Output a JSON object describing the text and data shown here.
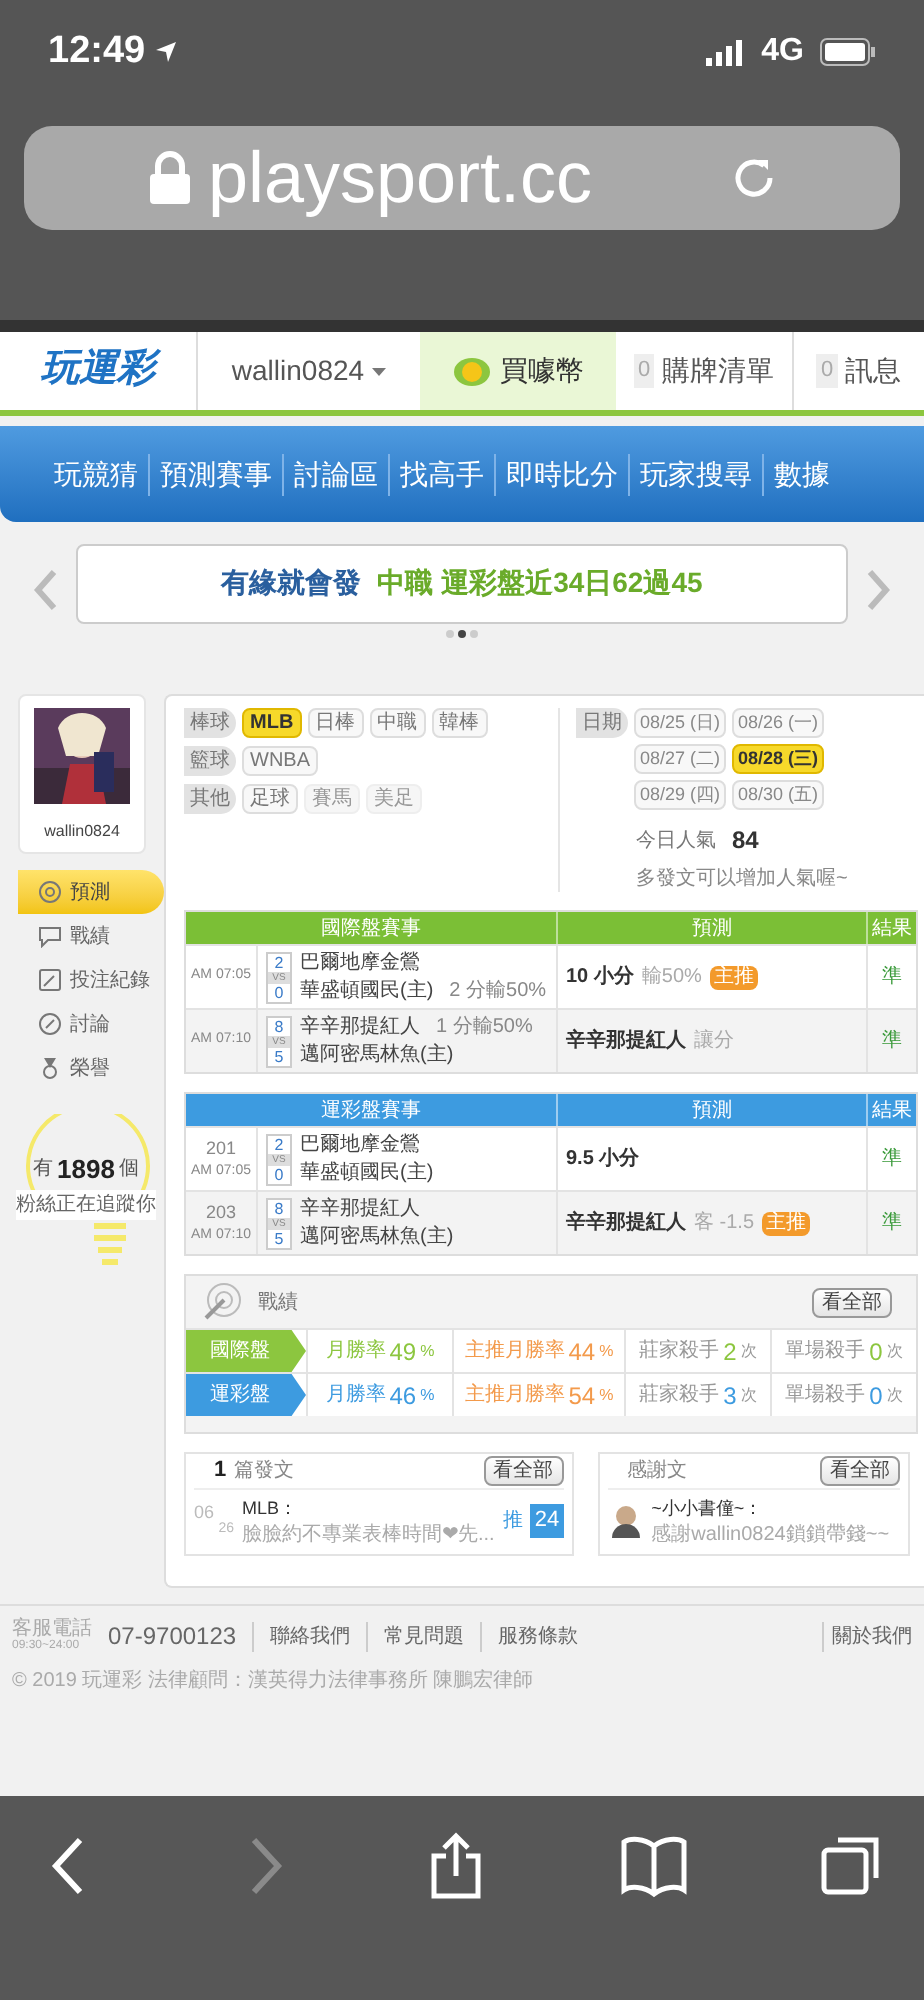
{
  "status_bar": {
    "time": "12:49",
    "network": "4G"
  },
  "browser": {
    "url": "playsport.cc"
  },
  "header": {
    "logo": "玩運彩",
    "username": "wallin0824",
    "coins_label": "買噱幣",
    "cart": {
      "count": "0",
      "label": "購牌清單"
    },
    "messages": {
      "count": "0",
      "label": "訊息"
    }
  },
  "nav": {
    "items": [
      "玩競猜",
      "預測賽事",
      "討論區",
      "找高手",
      "即時比分",
      "玩家搜尋",
      "數據"
    ]
  },
  "banner": {
    "lead": "有緣就會發",
    "highlight": "中職 運彩盤近34日62過45",
    "dots": [
      {
        "selected": false
      },
      {
        "selected": true
      },
      {
        "selected": false
      }
    ]
  },
  "profile": {
    "username": "wallin0824",
    "menu": [
      {
        "label": "預測",
        "kind": "target",
        "selected": true
      },
      {
        "label": "戰績",
        "kind": "chat",
        "selected": false
      },
      {
        "label": "投注紀錄",
        "kind": "pencil",
        "selected": false
      },
      {
        "label": "討論",
        "kind": "edit",
        "selected": false
      },
      {
        "label": "榮譽",
        "kind": "medal",
        "selected": false
      }
    ],
    "fans": {
      "prefix": "有",
      "count": "1898",
      "suffix": "個",
      "caption": "粉絲正在追蹤你"
    }
  },
  "filters": {
    "groups": [
      {
        "label": "棒球",
        "options": [
          {
            "label": "MLB",
            "selected": true,
            "disabled": false
          },
          {
            "label": "日棒",
            "selected": false,
            "disabled": false
          },
          {
            "label": "中職",
            "selected": false,
            "disabled": false
          },
          {
            "label": "韓棒",
            "selected": false,
            "disabled": false
          }
        ]
      },
      {
        "label": "籃球",
        "options": [
          {
            "label": "WNBA",
            "selected": false,
            "disabled": false
          }
        ]
      },
      {
        "label": "其他",
        "options": [
          {
            "label": "足球",
            "selected": false,
            "disabled": false
          },
          {
            "label": "賽馬",
            "selected": false,
            "disabled": true
          },
          {
            "label": "美足",
            "selected": false,
            "disabled": true
          }
        ]
      }
    ]
  },
  "dates": {
    "label": "日期",
    "items": [
      {
        "label": "08/25 (日)",
        "selected": false
      },
      {
        "label": "08/26 (一)",
        "selected": false
      },
      {
        "label": "08/27 (二)",
        "selected": false
      },
      {
        "label": "08/28 (三)",
        "selected": true
      },
      {
        "label": "08/29 (四)",
        "selected": false
      },
      {
        "label": "08/30 (五)",
        "selected": false
      }
    ]
  },
  "popularity": {
    "label": "今日人氣",
    "value": "84",
    "hint": "多發文可以增加人氣喔~"
  },
  "tables": [
    {
      "color": "#7bbf36",
      "columns": [
        "國際盤賽事",
        "預測",
        "結果"
      ],
      "rows": [
        {
          "time": "AM 07:05",
          "away_score": "2",
          "vs": "VS",
          "home_score": "0",
          "away": "巴爾地摩金鶯",
          "home": "華盛頓國民(主)",
          "home_line": "2 分輸50%",
          "pick": "10 小分",
          "pick_note": "輸50%",
          "badge": "主推",
          "result": "準"
        },
        {
          "time": "AM 07:10",
          "away_score": "8",
          "vs": "VS",
          "home_score": "5",
          "away": "辛辛那提紅人",
          "home": "邁阿密馬林魚(主)",
          "away_line": "1 分輸50%",
          "pick": "辛辛那提紅人",
          "pick_note": "讓分",
          "result": "準"
        }
      ]
    },
    {
      "color": "#3d9be0",
      "columns": [
        "運彩盤賽事",
        "預測",
        "結果"
      ],
      "rows": [
        {
          "number": "201",
          "time": "AM 07:05",
          "away_score": "2",
          "vs": "VS",
          "home_score": "0",
          "away": "巴爾地摩金鶯",
          "home": "華盛頓國民(主)",
          "pick": "9.5 小分",
          "result": "準"
        },
        {
          "number": "203",
          "time": "AM 07:10",
          "away_score": "8",
          "vs": "VS",
          "home_score": "5",
          "away": "辛辛那提紅人",
          "home": "邁阿密馬林魚(主)",
          "pick": "辛辛那提紅人",
          "pick_note": "客 -1.5",
          "badge": "主推",
          "result": "準"
        }
      ]
    }
  ],
  "stats": {
    "title": "戰績",
    "more": "看全部",
    "rows": [
      {
        "label": "國際盤",
        "color": "#8cc63f",
        "cells": [
          {
            "label": "月勝率",
            "value": "49",
            "unit": "%"
          },
          {
            "label": "主推月勝率",
            "value": "44",
            "unit": "%"
          },
          {
            "label": "莊家殺手",
            "value": "2",
            "unit": "次"
          },
          {
            "label": "單場殺手",
            "value": "0",
            "unit": "次"
          }
        ]
      },
      {
        "label": "運彩盤",
        "color": "#3d9be0",
        "cells": [
          {
            "label": "月勝率",
            "value": "46",
            "unit": "%"
          },
          {
            "label": "主推月勝率",
            "value": "54",
            "unit": "%"
          },
          {
            "label": "莊家殺手",
            "value": "3",
            "unit": "次"
          },
          {
            "label": "單場殺手",
            "value": "0",
            "unit": "次"
          }
        ]
      }
    ]
  },
  "posts": {
    "count": "1",
    "title": "篇發文",
    "more": "看全部",
    "items": [
      {
        "month": "06",
        "day": "26",
        "category": "MLB：",
        "excerpt": "臉臉約不專業表棒時間❤先...",
        "push_label": "推",
        "push": "24"
      }
    ]
  },
  "thanks": {
    "title": "感謝文",
    "more": "看全部",
    "items": [
      {
        "author": "~小小書僮~：",
        "text": "感謝wallin0824鎖鎖帶錢~~"
      }
    ]
  },
  "footer": {
    "phone_label": "客服電話",
    "hours": "09:30~24:00",
    "phone": "07-9700123",
    "links": [
      "聯絡我們",
      "常見問題",
      "服務條款"
    ],
    "about": "關於我們",
    "copyright": "© 2019 玩運彩 法律顧問：漢英得力法律事務所 陳鵬宏律師"
  }
}
